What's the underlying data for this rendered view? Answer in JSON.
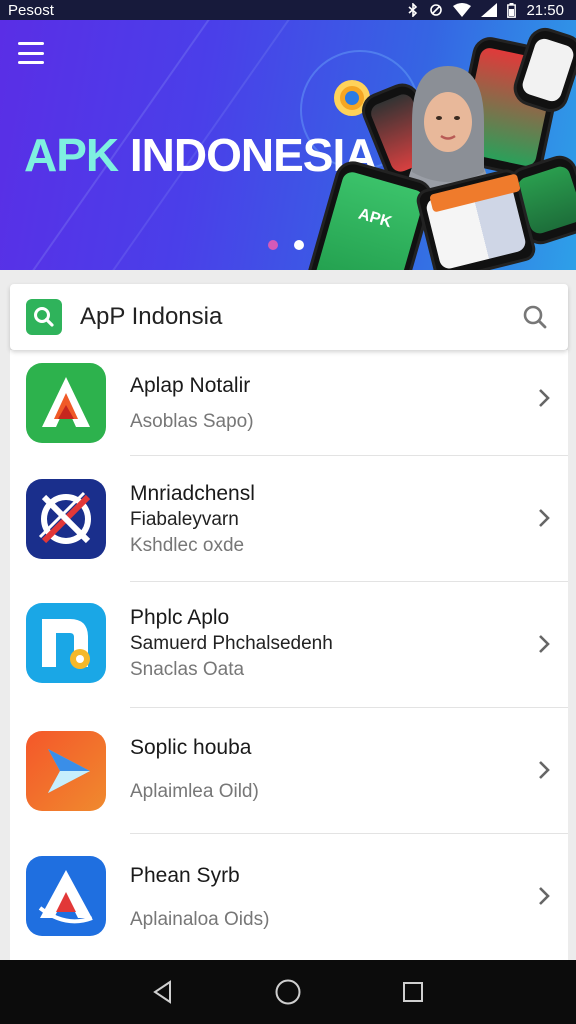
{
  "status_bar": {
    "carrier": "Pesost",
    "time": "21:50",
    "icons": [
      "bluetooth-icon",
      "sync-icon",
      "wifi-icon",
      "signal-icon",
      "battery-icon"
    ]
  },
  "banner": {
    "title_part1": "APK",
    "title_part2": "INDONESIA",
    "menu_icon": "hamburger-menu-icon",
    "carousel_active_index": 0,
    "carousel_count": 2,
    "phone_screen_text": "APK"
  },
  "search_bar": {
    "title": "ApP Indonsia",
    "logo_icon": "app-search-logo-icon",
    "search_icon": "search-icon"
  },
  "apps": [
    {
      "name": "Aplap Notalir",
      "line2": "",
      "line3": "Asoblas Sapo)",
      "icon": "green-triangle-app-icon",
      "icon_bg": "#2db24d"
    },
    {
      "name": "Mnriadchensl",
      "line2": "Fiabaleyvarn",
      "line3": "Kshdlec oxde",
      "icon": "navy-crossed-circle-app-icon",
      "icon_bg": "#1a2f8c"
    },
    {
      "name": "Phplc Aplo",
      "line2": "Samuerd Phchalsedenh",
      "line3": "Snaclas Oata",
      "icon": "blue-n-app-icon",
      "icon_bg": "#1aa7e6"
    },
    {
      "name": "Soplic houba",
      "line2": "",
      "line3": "Aplaimlea Oild)",
      "icon": "orange-play-app-icon",
      "icon_bg": "#f06a2e"
    },
    {
      "name": "Phean Syrb",
      "line2": "",
      "line3": "Aplainaloa Oids)",
      "icon": "blue-a-app-icon",
      "icon_bg": "#1f6fe0"
    }
  ],
  "nav_bar": {
    "back": "back-triangle-icon",
    "home": "home-circle-icon",
    "recents": "recents-square-icon"
  },
  "colors": {
    "banner_start": "#5a2ee6",
    "banner_end": "#2ea0e8",
    "accent_green": "#2fb35b",
    "nav_bg": "#0c0c0c"
  }
}
